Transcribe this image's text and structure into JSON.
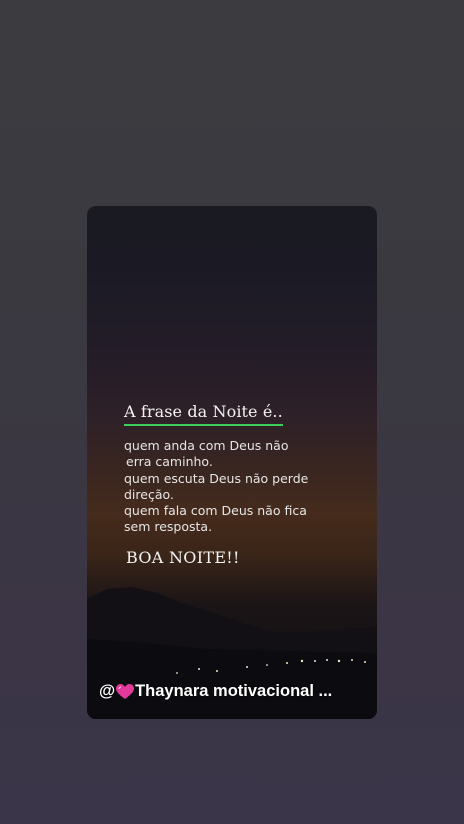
{
  "story": {
    "title": "A frase da Noite é..",
    "quote_lines": [
      "quem anda com Deus não",
      "erra caminho.",
      "quem escuta Deus não perde",
      "direção.",
      "quem fala com Deus não fica",
      "sem resposta."
    ],
    "closing": "BOA NOITE!!",
    "watermark": {
      "prefix": "@",
      "icon": "heart-icon",
      "name": "Thaynara motivacional ..."
    }
  },
  "colors": {
    "underline_accent": "#3ecf5a",
    "heart": "#e23a9a"
  }
}
